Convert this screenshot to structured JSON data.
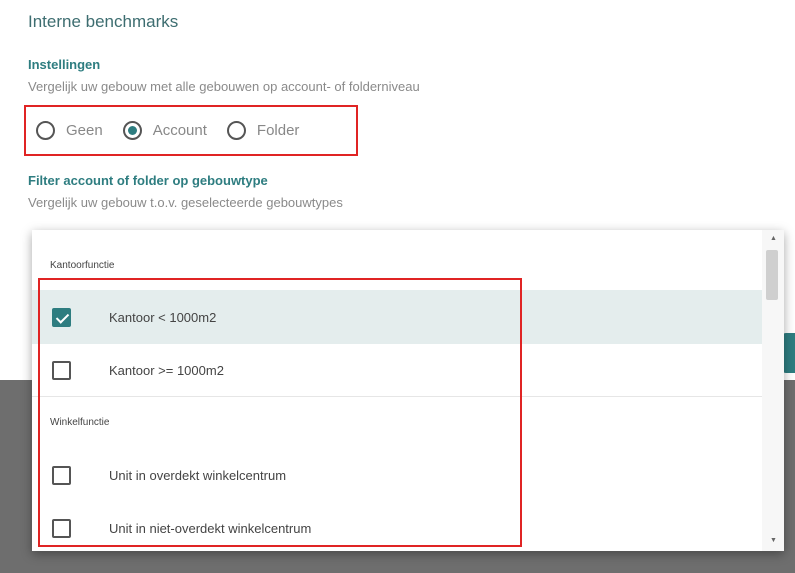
{
  "page": {
    "title": "Interne benchmarks"
  },
  "settings": {
    "title": "Instellingen",
    "description": "Vergelijk uw gebouw met alle gebouwen op account- of folderniveau",
    "options": [
      {
        "label": "Geen",
        "checked": false
      },
      {
        "label": "Account",
        "checked": true
      },
      {
        "label": "Folder",
        "checked": false
      }
    ]
  },
  "filter": {
    "title": "Filter account of folder op gebouwtype",
    "description": "Vergelijk uw gebouw t.o.v. geselecteerde gebouwtypes"
  },
  "dropdown": {
    "groups": [
      {
        "label": "Kantoorfunctie",
        "items": [
          {
            "label": "Kantoor < 1000m2",
            "checked": true
          },
          {
            "label": "Kantoor >= 1000m2",
            "checked": false
          }
        ]
      },
      {
        "label": "Winkelfunctie",
        "items": [
          {
            "label": "Unit in overdekt winkelcentrum",
            "checked": false
          },
          {
            "label": "Unit in niet-overdekt winkelcentrum",
            "checked": false
          }
        ]
      }
    ],
    "scroll_up_glyph": "▲",
    "scroll_down_glyph": "▼"
  },
  "colors": {
    "accent": "#2e7d80",
    "highlight": "#e02424",
    "selected_row": "#e4eded"
  }
}
